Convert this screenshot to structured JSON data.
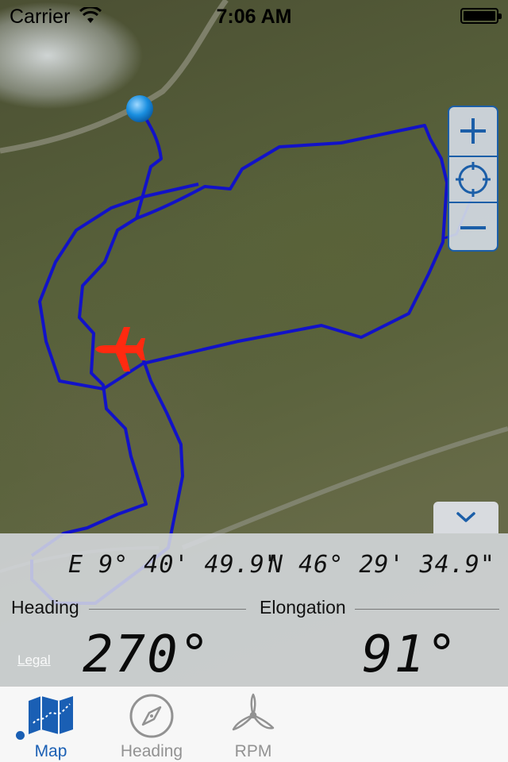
{
  "status_bar": {
    "carrier": "Carrier",
    "time": "7:06 AM"
  },
  "map": {
    "track_color": "#1212c8",
    "aircraft_color": "#ff2a10",
    "start_marker_color": "#1a8fe0"
  },
  "zoom_controls": {
    "zoom_in_icon": "plus-icon",
    "locate_icon": "crosshair-icon",
    "zoom_out_icon": "minus-icon"
  },
  "info_panel": {
    "longitude": "E 9° 40' 49.9\"",
    "latitude": "N 46° 29' 34.9\"",
    "heading_label": "Heading",
    "heading_value": "270°",
    "elongation_label": "Elongation",
    "elongation_value": "91°",
    "legal": "Legal"
  },
  "tab_bar": {
    "tabs": [
      {
        "label": "Map",
        "icon": "map-icon",
        "selected": true
      },
      {
        "label": "Heading",
        "icon": "compass-icon",
        "selected": false
      },
      {
        "label": "RPM",
        "icon": "propeller-icon",
        "selected": false
      }
    ],
    "accent": "#1a5fb4",
    "inactive": "#929292"
  }
}
